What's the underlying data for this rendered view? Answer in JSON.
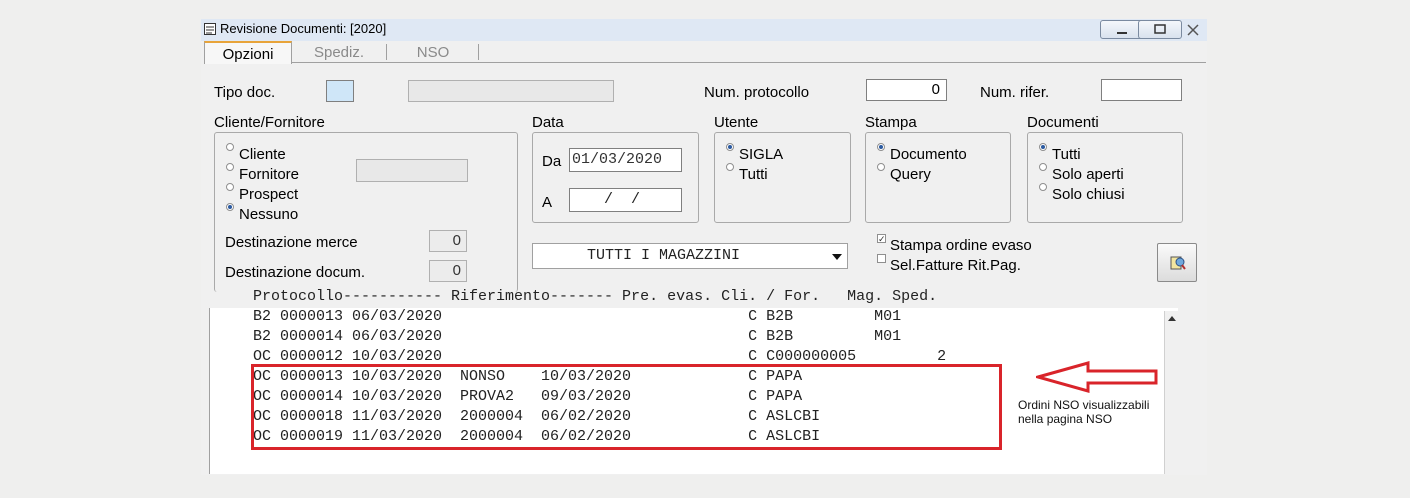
{
  "window": {
    "title": "Revisione Documenti: [2020]"
  },
  "tabs": [
    {
      "label": "Opzioni"
    },
    {
      "label": "Spediz."
    },
    {
      "label": "NSO"
    }
  ],
  "form": {
    "tipo_doc_label": "Tipo doc.",
    "num_protocollo_label": "Num. protocollo",
    "num_protocollo_value": "0",
    "num_rifer_label": "Num. rifer.",
    "cliente_fornitore": {
      "title": "Cliente/Fornitore",
      "options": [
        "Cliente",
        "Fornitore",
        "Prospect",
        "Nessuno"
      ],
      "selected": "Nessuno",
      "dest_merce_label": "Destinazione merce",
      "dest_merce_value": "0",
      "dest_docum_label": "Destinazione docum.",
      "dest_docum_value": "0"
    },
    "data": {
      "title": "Data",
      "da_label": "Da",
      "da_value": "01/03/2020",
      "a_label": "A",
      "a_value": "  /  /"
    },
    "utente": {
      "title": "Utente",
      "options": [
        "SIGLA",
        "Tutti"
      ],
      "selected": "SIGLA"
    },
    "stampa": {
      "title": "Stampa",
      "options": [
        "Documento",
        "Query"
      ],
      "selected": "Documento"
    },
    "documenti": {
      "title": "Documenti",
      "options": [
        "Tutti",
        "Solo aperti",
        "Solo chiusi"
      ],
      "selected": "Tutti"
    },
    "magazzino_value": "TUTTI I MAGAZZINI",
    "stampa_ordine_evaso_label": "Stampa ordine evaso",
    "stampa_ordine_evaso_checked": true,
    "sel_fatture_label": "Sel.Fatture Rit.Pag.",
    "sel_fatture_checked": false
  },
  "list": {
    "header": "Protocollo----------- Riferimento------- Pre. evas. Cli. / For.   Mag. Sped.",
    "rows": [
      "B2 0000013 06/03/2020                                  C B2B         M01",
      "B2 0000014 06/03/2020                                  C B2B         M01",
      "OC 0000012 10/03/2020                                  C C000000005         2",
      "OC 0000013 10/03/2020  NONSO    10/03/2020             C PAPA",
      "OC 0000014 10/03/2020  PROVA2   09/03/2020             C PAPA",
      "OC 0000018 11/03/2020  2000004  06/02/2020             C ASLCBI",
      "OC 0000019 11/03/2020  2000004  06/02/2020             C ASLCBI"
    ]
  },
  "annotation": {
    "line1": "Ordini NSO visualizzabili",
    "line2": "nella pagina NSO",
    "color": "#d9242a"
  }
}
